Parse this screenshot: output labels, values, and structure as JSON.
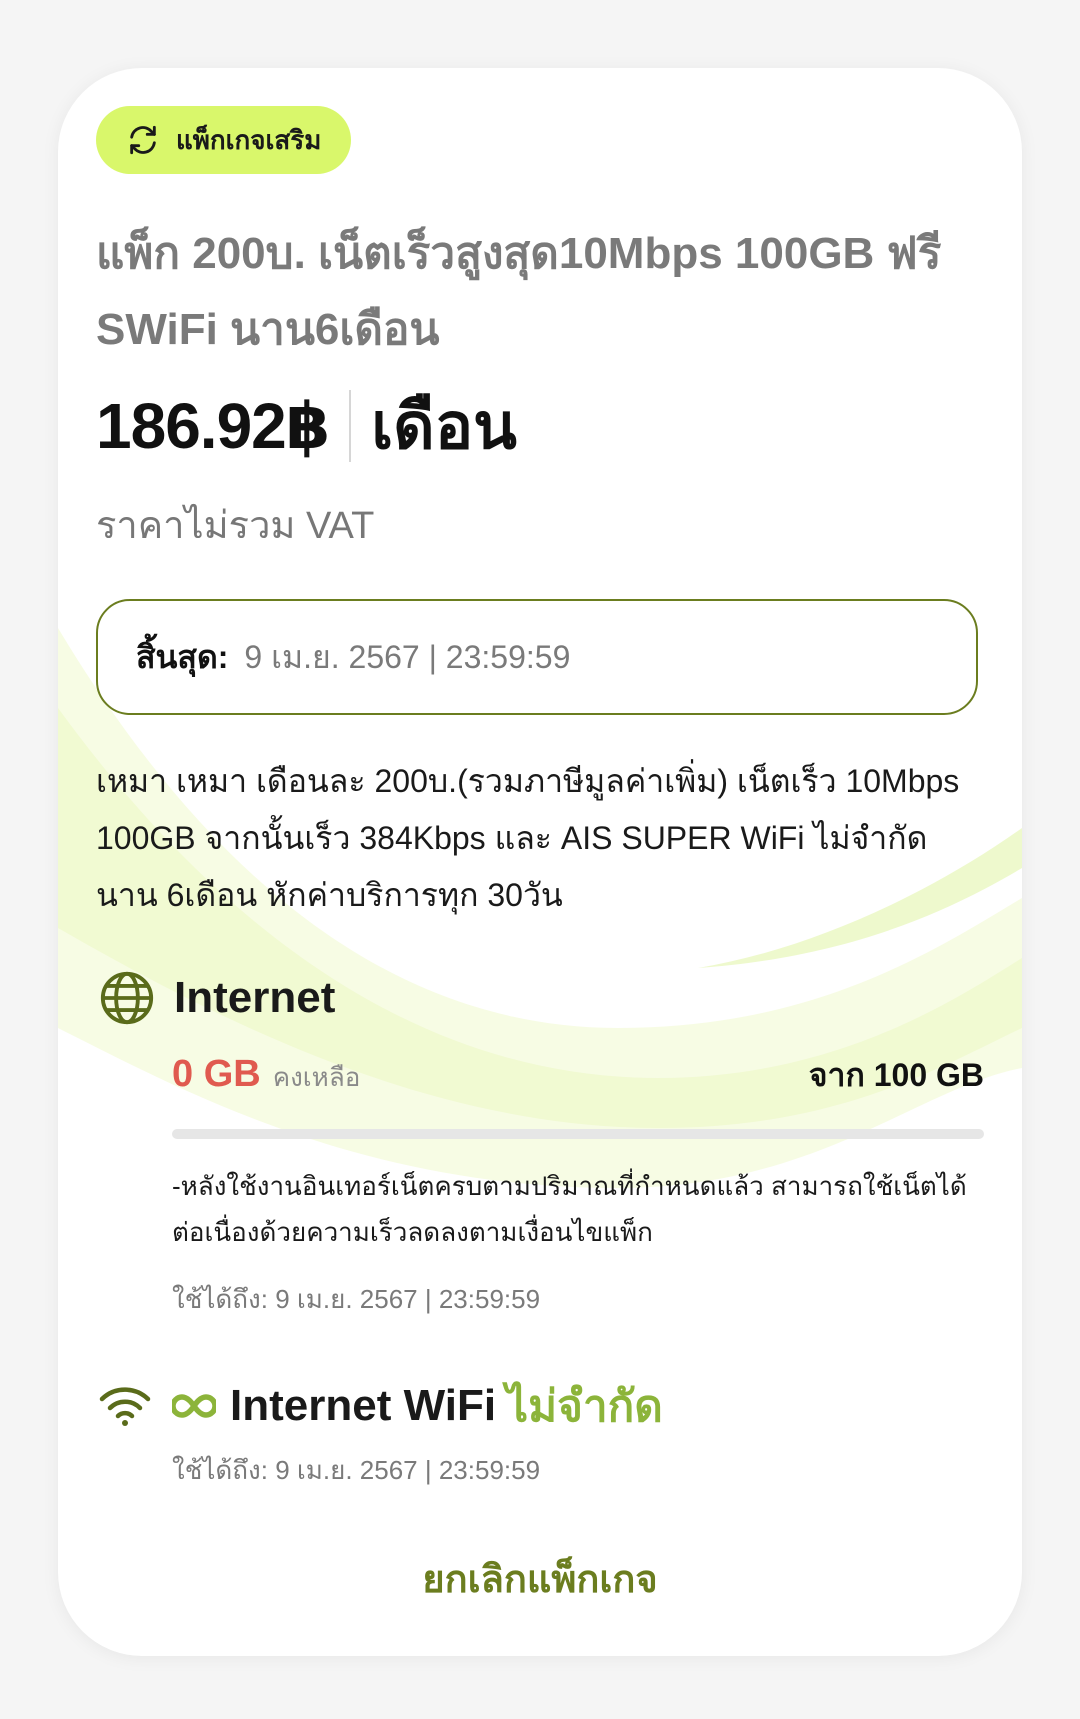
{
  "colors": {
    "accent": "#6b7d1f",
    "chip_bg": "#d9f76b",
    "remaining": "#e05a4f",
    "unlimited": "#8cb43a"
  },
  "chip": {
    "icon": "refresh-icon",
    "label": "แพ็กเกจเสริม"
  },
  "package": {
    "title": "แพ็ก 200บ. เน็ตเร็วสูงสุด10Mbps 100GB ฟรี SWiFi นาน6เดือน",
    "price": "186.92฿",
    "period": "เดือน",
    "vat_note": "ราคาไม่รวม VAT",
    "expiry_label": "สิ้นสุด:",
    "expiry_value": "9 เม.ย. 2567 | 23:59:59",
    "description": "เหมา เหมา เดือนละ 200บ.(รวมภาษีมูลค่าเพิ่ม) เน็ตเร็ว 10Mbps 100GB จากนั้นเร็ว 384Kbps และ AIS SUPER WiFi ไม่จำกัด นาน 6เดือน หักค่าบริการทุก 30วัน"
  },
  "internet": {
    "icon": "globe-icon",
    "title": "Internet",
    "remaining": "0 GB",
    "remaining_label": "คงเหลือ",
    "total": "จาก 100 GB",
    "remaining_fraction": 0,
    "note": "-หลังใช้งานอินเทอร์เน็ตครบตามปริมาณที่กำหนดแล้ว สามารถใช้เน็ตได้ต่อเนื่องด้วยความเร็วลดลงตามเงื่อนไขแพ็ก",
    "valid_until": "ใช้ได้ถึง: 9 เม.ย. 2567 | 23:59:59"
  },
  "wifi": {
    "icon": "wifi-icon",
    "infinity_icon": "infinity-icon",
    "title": "Internet WiFi",
    "unlimited": "ไม่จำกัด",
    "valid_until": "ใช้ได้ถึง: 9 เม.ย. 2567 | 23:59:59"
  },
  "actions": {
    "cancel_label": "ยกเลิกแพ็กเกจ"
  }
}
